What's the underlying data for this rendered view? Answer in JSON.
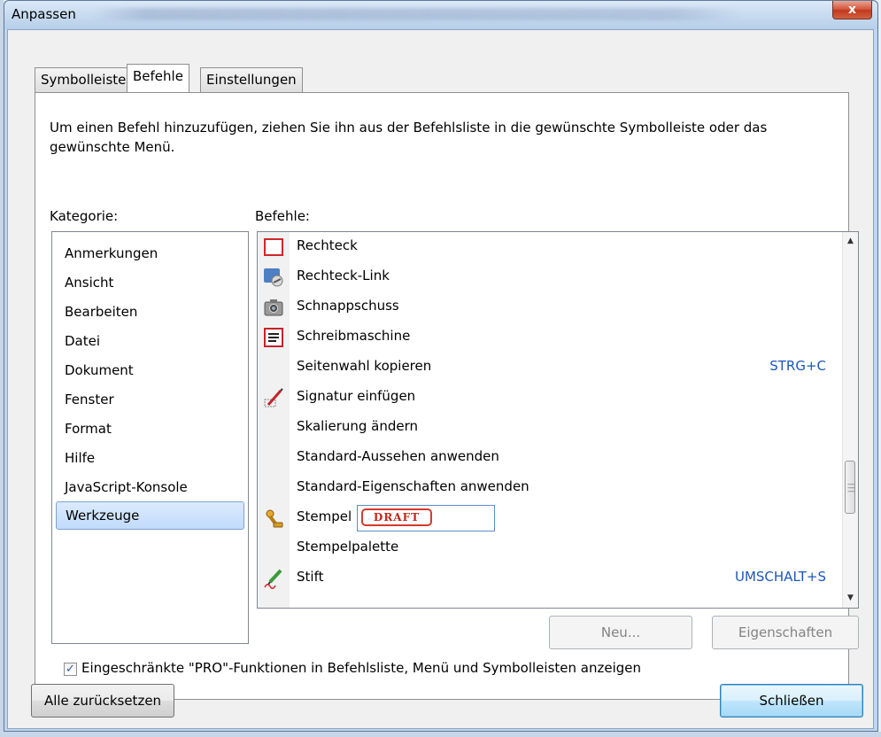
{
  "window": {
    "title": "Anpassen",
    "close_glyph": "x"
  },
  "tabs": [
    {
      "label": "Symbolleisten",
      "active": false
    },
    {
      "label": "Befehle",
      "active": true
    },
    {
      "label": "Einstellungen",
      "active": false
    }
  ],
  "instruction": "Um einen Befehl hinzuzufügen, ziehen Sie ihn aus der Befehlsliste in die gewünschte Symbolleiste oder das gewünschte Menü.",
  "category": {
    "label": "Kategorie:",
    "items": [
      "Anmerkungen",
      "Ansicht",
      "Bearbeiten",
      "Datei",
      "Dokument",
      "Fenster",
      "Format",
      "Hilfe",
      "JavaScript-Konsole",
      "Werkzeuge"
    ],
    "selected": "Werkzeuge"
  },
  "commands": {
    "label": "Befehle:",
    "items": [
      {
        "label": "Rechteck",
        "icon": "rectangle-icon",
        "shortcut": ""
      },
      {
        "label": "Rechteck-Link",
        "icon": "link-icon",
        "shortcut": ""
      },
      {
        "label": "Schnappschuss",
        "icon": "camera-icon",
        "shortcut": ""
      },
      {
        "label": "Schreibmaschine",
        "icon": "typewriter-icon",
        "shortcut": ""
      },
      {
        "label": "Seitenwahl kopieren",
        "icon": "",
        "shortcut": "STRG+C"
      },
      {
        "label": "Signatur einfügen",
        "icon": "signature-icon",
        "shortcut": ""
      },
      {
        "label": "Skalierung ändern",
        "icon": "",
        "shortcut": ""
      },
      {
        "label": "Standard-Aussehen anwenden",
        "icon": "",
        "shortcut": ""
      },
      {
        "label": "Standard-Eigenschaften anwenden",
        "icon": "",
        "shortcut": ""
      },
      {
        "label": "Stempel",
        "icon": "stamp-icon",
        "shortcut": "",
        "stamp_preview": "DRAFT"
      },
      {
        "label": "Stempelpalette",
        "icon": "",
        "shortcut": ""
      },
      {
        "label": "Stift",
        "icon": "pen-icon",
        "shortcut": "UMSCHALT+S"
      }
    ]
  },
  "buttons": {
    "new": "Neu...",
    "properties": "Eigenschaften",
    "reset_all": "Alle zurücksetzen",
    "close": "Schließen"
  },
  "pro_option": {
    "checked": true,
    "label": "Eingeschränkte \"PRO\"-Funktionen in Befehlsliste, Menü und Symbolleisten anzeigen"
  },
  "colors": {
    "shortcut": "#1c57b8",
    "stamp_red": "#d23b2b",
    "selection": "#c1dbfc"
  }
}
